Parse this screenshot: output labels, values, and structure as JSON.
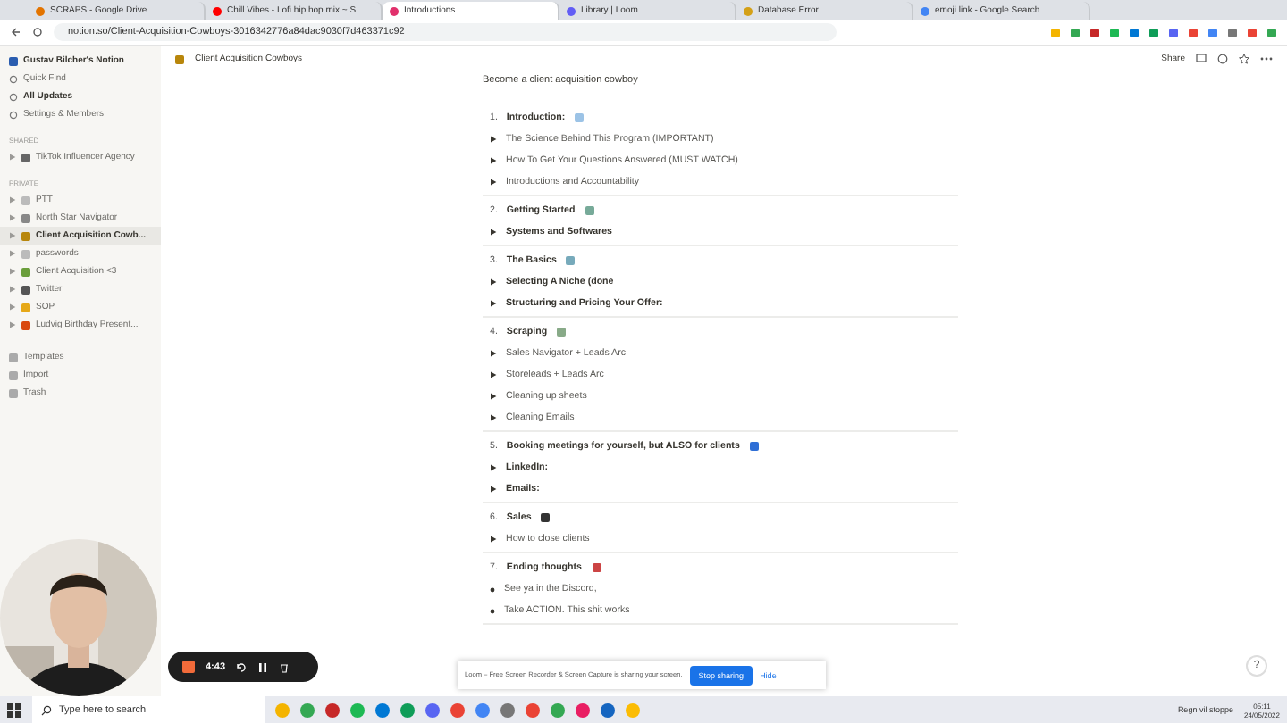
{
  "browser": {
    "tabs": [
      {
        "label": "SCRAPS - Google Drive",
        "selected": false
      },
      {
        "label": "Chill Vibes - Lofi hip hop mix ~ S",
        "selected": false
      },
      {
        "label": "Introductions",
        "selected": true
      },
      {
        "label": "Library | Loom",
        "selected": false
      },
      {
        "label": "Database Error",
        "selected": false
      },
      {
        "label": "emoji link - Google Search",
        "selected": false
      }
    ],
    "url": "notion.so/Client-Acquisition-Cowboys-3016342776a84dac9030f7d463371c92"
  },
  "sidebar": {
    "workspace": "Gustav Bilcher's Notion",
    "actions": [
      {
        "label": "Quick Find",
        "selected": false
      },
      {
        "label": "All Updates",
        "selected": true
      },
      {
        "label": "Settings & Members",
        "selected": false
      }
    ],
    "shared_heading": "SHARED",
    "shared": [
      {
        "label": "TikTok Influencer Agency",
        "selected": false
      }
    ],
    "private_heading": "PRIVATE",
    "private": [
      {
        "label": "PTT",
        "selected": false
      },
      {
        "label": "North Star Navigator",
        "selected": false
      },
      {
        "label": "Client Acquisition Cowb...",
        "selected": true
      },
      {
        "label": "passwords",
        "selected": false
      },
      {
        "label": "Client Acquisition <3",
        "selected": false
      },
      {
        "label": "Twitter",
        "selected": false
      },
      {
        "label": "SOP",
        "selected": false
      },
      {
        "label": "Ludvig Birthday Present..."
      }
    ],
    "footer": [
      "Templates",
      "Import",
      "Trash"
    ]
  },
  "breadcrumb": "Client Acquisition Cowboys",
  "topbar_share": "Share",
  "page": {
    "subtitle": "Become a client acquisition cowboy",
    "sections": [
      {
        "number": "1.",
        "title": "Introduction:",
        "items": [
          {
            "kind": "toggle",
            "text": "The Science Behind This Program (IMPORTANT)",
            "bold": false
          },
          {
            "kind": "toggle",
            "text": "How To Get Your Questions Answered (MUST WATCH)",
            "bold": false
          },
          {
            "kind": "toggle",
            "text": "Introductions and Accountability",
            "bold": false
          }
        ]
      },
      {
        "number": "2.",
        "title": "Getting Started",
        "items": [
          {
            "kind": "toggle",
            "text": "Systems and Softwares",
            "bold": true
          }
        ]
      },
      {
        "number": "3.",
        "title": "The Basics",
        "items": [
          {
            "kind": "toggle",
            "text": "Selecting A Niche (done",
            "bold": true
          },
          {
            "kind": "toggle",
            "text": "Structuring and Pricing Your Offer:",
            "bold": true
          }
        ]
      },
      {
        "number": "4.",
        "title": "Scraping",
        "items": [
          {
            "kind": "toggle",
            "text": "Sales Navigator + Leads Arc",
            "bold": false
          },
          {
            "kind": "toggle",
            "text": "Storeleads + Leads Arc",
            "bold": false
          },
          {
            "kind": "toggle",
            "text": "Cleaning up sheets",
            "bold": false
          },
          {
            "kind": "toggle",
            "text": "Cleaning Emails",
            "bold": false
          }
        ]
      },
      {
        "number": "5.",
        "title": "Booking meetings for yourself, but ALSO for clients",
        "items": [
          {
            "kind": "toggle",
            "text": "LinkedIn:",
            "bold": true
          },
          {
            "kind": "toggle",
            "text": "Emails:",
            "bold": true
          }
        ]
      },
      {
        "number": "6.",
        "title": "Sales",
        "items": [
          {
            "kind": "toggle",
            "text": "How to close clients",
            "bold": false
          }
        ]
      },
      {
        "number": "7.",
        "title": "Ending thoughts",
        "items": [
          {
            "kind": "bullet",
            "text": "See ya in the Discord,",
            "bold": false
          },
          {
            "kind": "bullet",
            "text": "Take ACTION. This shit works",
            "bold": false
          }
        ]
      }
    ]
  },
  "recorder": {
    "time": "4:43"
  },
  "loom_banner": {
    "message": "Loom – Free Screen Recorder & Screen Capture is sharing your screen.",
    "stop": "Stop sharing",
    "hide": "Hide"
  },
  "help": "?",
  "taskbar": {
    "search_placeholder": "Type here to search",
    "weather": "Regn vil stoppe",
    "time": "05:11",
    "date": "24/05/2022"
  }
}
